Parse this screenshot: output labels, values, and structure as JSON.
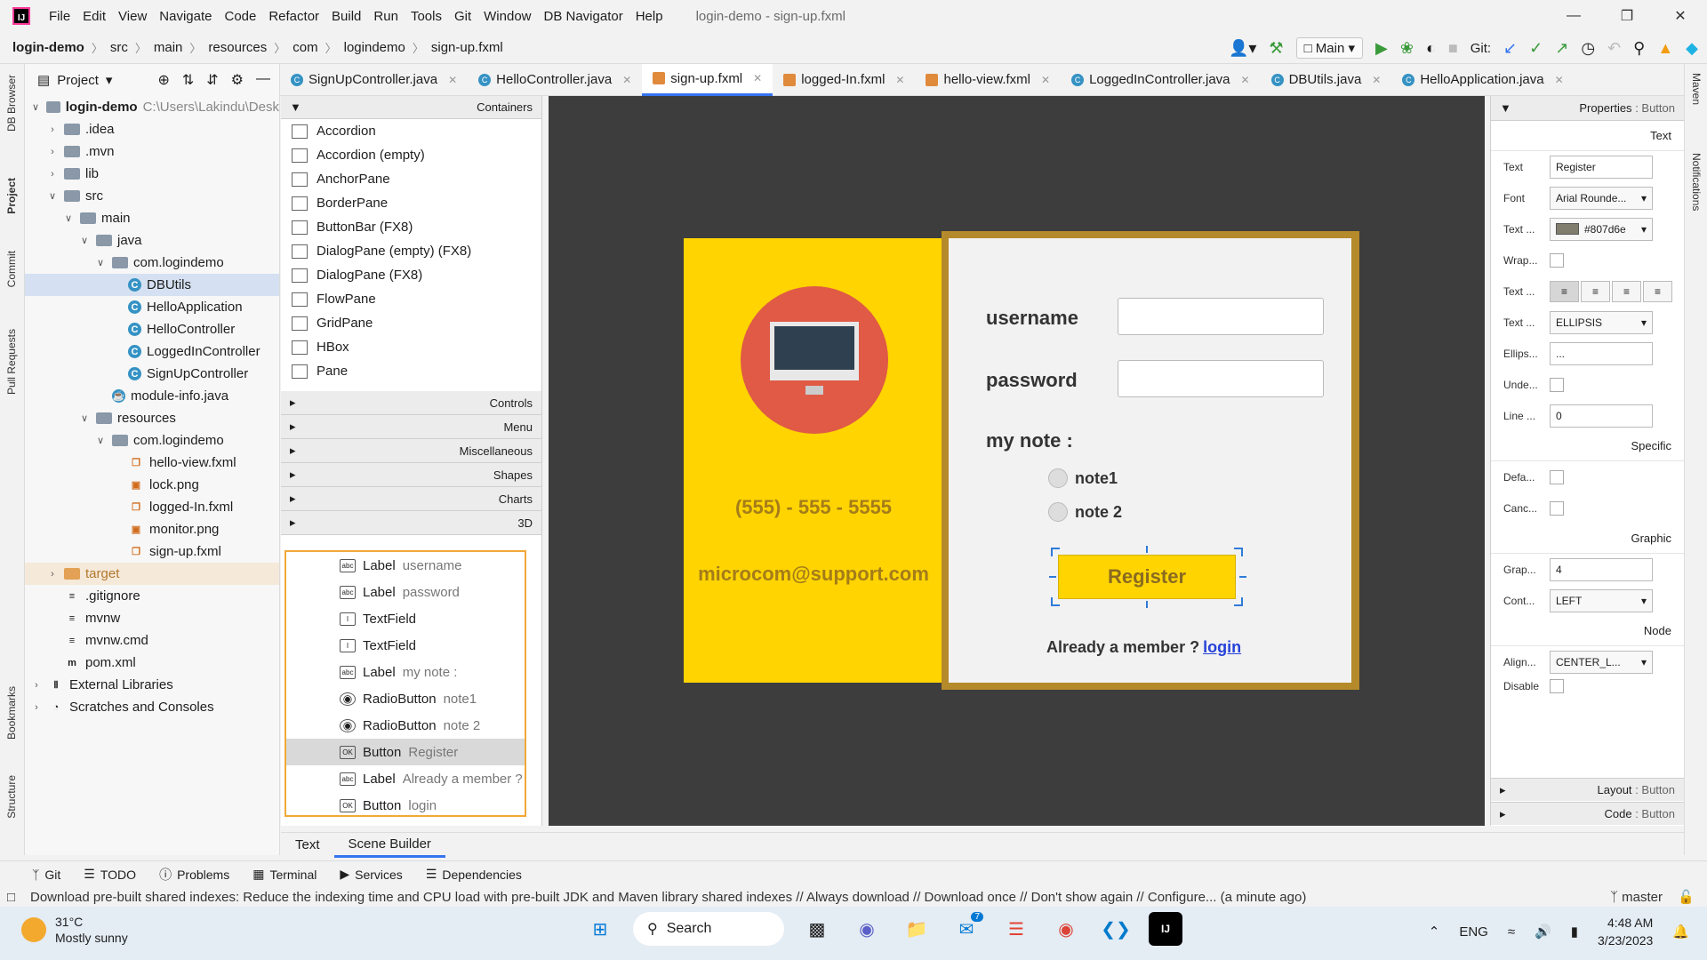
{
  "menubar": {
    "items": [
      "File",
      "Edit",
      "View",
      "Navigate",
      "Code",
      "Refactor",
      "Build",
      "Run",
      "Tools",
      "Git",
      "Window",
      "DB Navigator",
      "Help"
    ],
    "title": "login-demo - sign-up.fxml"
  },
  "breadcrumb": [
    "login-demo",
    "src",
    "main",
    "resources",
    "com",
    "logindemo",
    "sign-up.fxml"
  ],
  "toolbar": {
    "run_config": "Main",
    "git_label": "Git:"
  },
  "left_strip": [
    "DB Browser",
    "Project",
    "Commit",
    "Pull Requests",
    "Bookmarks",
    "Structure"
  ],
  "right_strip": [
    "Maven",
    "Notifications"
  ],
  "project": {
    "title": "Project",
    "tree": [
      {
        "label": "login-demo",
        "extra": "C:\\Users\\Lakindu\\Desk",
        "type": "root",
        "depth": 0,
        "open": true
      },
      {
        "label": ".idea",
        "type": "folder",
        "depth": 1,
        "open": false
      },
      {
        "label": ".mvn",
        "type": "folder",
        "depth": 1,
        "open": false
      },
      {
        "label": "lib",
        "type": "folder",
        "depth": 1,
        "open": false
      },
      {
        "label": "src",
        "type": "folder",
        "depth": 1,
        "open": true
      },
      {
        "label": "main",
        "type": "folder",
        "depth": 2,
        "open": true
      },
      {
        "label": "java",
        "type": "folder",
        "depth": 3,
        "open": true
      },
      {
        "label": "com.logindemo",
        "type": "package",
        "depth": 4,
        "open": true
      },
      {
        "label": "DBUtils",
        "type": "class",
        "depth": 5,
        "selected": true
      },
      {
        "label": "HelloApplication",
        "type": "class",
        "depth": 5
      },
      {
        "label": "HelloController",
        "type": "class",
        "depth": 5
      },
      {
        "label": "LoggedInController",
        "type": "class",
        "depth": 5
      },
      {
        "label": "SignUpController",
        "type": "class",
        "depth": 5
      },
      {
        "label": "module-info.java",
        "type": "java",
        "depth": 4
      },
      {
        "label": "resources",
        "type": "folder",
        "depth": 3,
        "open": true
      },
      {
        "label": "com.logindemo",
        "type": "package",
        "depth": 4,
        "open": true
      },
      {
        "label": "hello-view.fxml",
        "type": "fxml",
        "depth": 5
      },
      {
        "label": "lock.png",
        "type": "image",
        "depth": 5
      },
      {
        "label": "logged-In.fxml",
        "type": "fxml",
        "depth": 5
      },
      {
        "label": "monitor.png",
        "type": "image",
        "depth": 5
      },
      {
        "label": "sign-up.fxml",
        "type": "fxml",
        "depth": 5
      },
      {
        "label": "target",
        "type": "folder-orange",
        "depth": 1,
        "open": false,
        "excluded": true
      },
      {
        "label": ".gitignore",
        "type": "file",
        "depth": 1
      },
      {
        "label": "mvnw",
        "type": "file",
        "depth": 1
      },
      {
        "label": "mvnw.cmd",
        "type": "file",
        "depth": 1
      },
      {
        "label": "pom.xml",
        "type": "maven",
        "depth": 1
      },
      {
        "label": "External Libraries",
        "type": "libs",
        "depth": 0,
        "open": false
      },
      {
        "label": "Scratches and Consoles",
        "type": "scratch",
        "depth": 0,
        "open": false
      }
    ]
  },
  "editor_tabs": [
    {
      "label": "SignUpController.java",
      "kind": "class"
    },
    {
      "label": "HelloController.java",
      "kind": "class"
    },
    {
      "label": "sign-up.fxml",
      "kind": "fxml",
      "active": true
    },
    {
      "label": "logged-In.fxml",
      "kind": "fxml"
    },
    {
      "label": "hello-view.fxml",
      "kind": "fxml"
    },
    {
      "label": "LoggedInController.java",
      "kind": "class"
    },
    {
      "label": "DBUtils.java",
      "kind": "class"
    },
    {
      "label": "HelloApplication.java",
      "kind": "class"
    }
  ],
  "library": {
    "header": "Containers",
    "items": [
      "Accordion",
      "Accordion  (empty)",
      "AnchorPane",
      "BorderPane",
      "ButtonBar  (FX8)",
      "DialogPane (empty)  (FX8)",
      "DialogPane  (FX8)",
      "FlowPane",
      "GridPane",
      "HBox",
      "Pane"
    ],
    "sections": [
      "Controls",
      "Menu",
      "Miscellaneous",
      "Shapes",
      "Charts",
      "3D"
    ]
  },
  "hierarchy": [
    {
      "type": "Label",
      "name": "username"
    },
    {
      "type": "Label",
      "name": "password"
    },
    {
      "type": "TextField",
      "name": ""
    },
    {
      "type": "TextField",
      "name": ""
    },
    {
      "type": "Label",
      "name": "my note :"
    },
    {
      "type": "RadioButton",
      "name": "note1"
    },
    {
      "type": "RadioButton",
      "name": "note 2"
    },
    {
      "type": "Button",
      "name": "Register",
      "selected": true
    },
    {
      "type": "Label",
      "name": "Already a member ?"
    },
    {
      "type": "Button",
      "name": "login"
    }
  ],
  "form": {
    "phone": "(555) - 555 - 5555",
    "email": "microcom@support.com",
    "username_label": "username",
    "password_label": "password",
    "note_label": "my note :",
    "radio1": "note1",
    "radio2": "note 2",
    "register": "Register",
    "already": "Already a member ?",
    "login": "login"
  },
  "properties": {
    "header": "Properties",
    "header_target": ": Button",
    "section_text": "Text",
    "text_label": "Text",
    "text_value": "Register",
    "font_label": "Font",
    "font_value": "Arial Rounde...",
    "fill_label": "Text ...",
    "fill_value": "#807d6e",
    "wrap_label": "Wrap...",
    "align_label": "Text ...",
    "overrun_label": "Text ...",
    "overrun_value": "ELLIPSIS",
    "ellipsis_label": "Ellips...",
    "ellipsis_value": "...",
    "underline_label": "Unde...",
    "line_label": "Line ...",
    "line_value": "0",
    "section_specific": "Specific",
    "default_label": "Defa...",
    "cancel_label": "Canc...",
    "section_graphic": "Graphic",
    "graphic_label": "Grap...",
    "graphic_value": "4",
    "content_label": "Cont...",
    "content_value": "LEFT",
    "section_node": "Node",
    "alignment_label": "Align...",
    "alignment_value": "CENTER_L...",
    "disable_label": "Disable",
    "layout": "Layout",
    "code": "Code",
    "footer_target": ": Button"
  },
  "bottom_tabs": {
    "text": "Text",
    "scene_builder": "Scene Builder"
  },
  "tool_windows": [
    "Git",
    "TODO",
    "Problems",
    "Terminal",
    "Services",
    "Dependencies"
  ],
  "status": {
    "message": "Download pre-built shared indexes: Reduce the indexing time and CPU load with pre-built JDK and Maven library shared indexes // Always download // Download once // Don't show again // Configure... (a minute ago)",
    "branch": "master"
  },
  "taskbar": {
    "temp": "31°C",
    "weather": "Mostly sunny",
    "search": "Search",
    "mail_badge": "7",
    "lang": "ENG",
    "time": "4:48 AM",
    "date": "3/23/2023"
  }
}
